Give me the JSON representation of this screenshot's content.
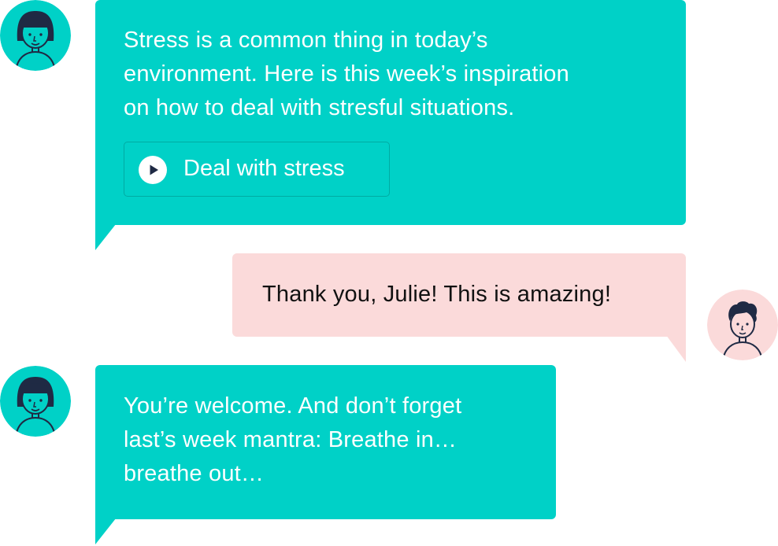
{
  "colors": {
    "agent_bubble": "#00d1c7",
    "user_bubble": "#fbdada",
    "agent_text": "#ffffff",
    "user_text": "#111111",
    "avatar_line": "#1f2a44"
  },
  "messages": [
    {
      "sender": "agent",
      "avatar_icon": "woman-avatar-icon",
      "lines": [
        "Stress is a common thing in today’s",
        "environment. Here is this week’s inspiration",
        "on how to deal with stresful situations."
      ],
      "link": {
        "icon": "play-icon",
        "label": "Deal with stress"
      }
    },
    {
      "sender": "user",
      "avatar_icon": "man-avatar-icon",
      "lines": [
        "Thank you, Julie! This is amazing!"
      ]
    },
    {
      "sender": "agent",
      "avatar_icon": "woman-avatar-icon",
      "lines": [
        "You’re welcome. And don’t forget",
        "last’s week mantra: Breathe in…",
        "breathe out…"
      ]
    }
  ]
}
